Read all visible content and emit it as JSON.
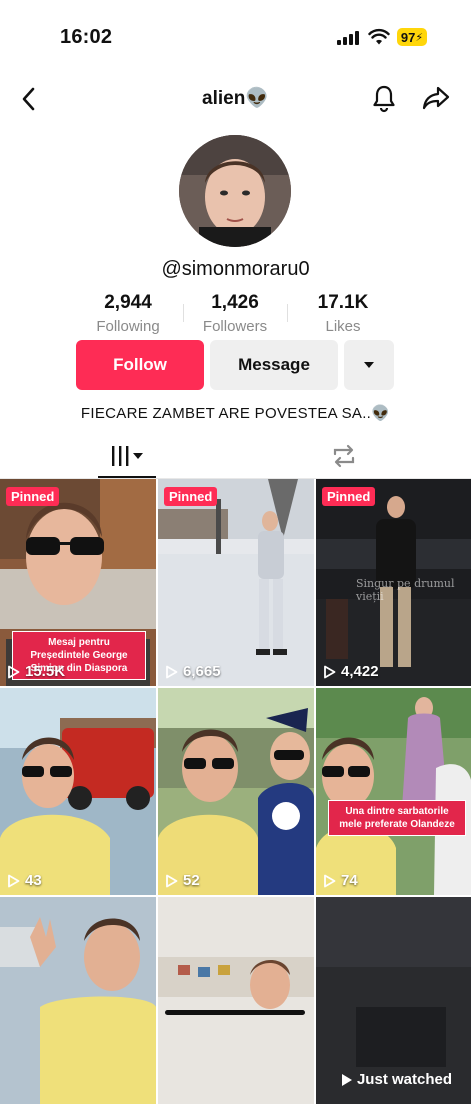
{
  "status_bar": {
    "time": "16:02",
    "battery": "97"
  },
  "header": {
    "title": "alien👽"
  },
  "profile": {
    "handle": "@simonmoraru0",
    "stats": [
      {
        "value": "2,944",
        "label": "Following"
      },
      {
        "value": "1,426",
        "label": "Followers"
      },
      {
        "value": "17.1K",
        "label": "Likes"
      }
    ],
    "follow_label": "Follow",
    "message_label": "Message",
    "bio": "FIECARE ZAMBET ARE POVESTEA SA..👽"
  },
  "colors": {
    "accent": "#fe2c55",
    "battery": "#ffd60a",
    "secondary_button": "#efefef"
  },
  "videos": [
    {
      "pinned": "Pinned",
      "views": "15.5K",
      "caption": "Mesaj pentru Președintele George Simion din Diaspora"
    },
    {
      "pinned": "Pinned",
      "views": "6,665"
    },
    {
      "pinned": "Pinned",
      "views": "4,422",
      "caption": "Singur pe drumul vieții"
    },
    {
      "views": "43"
    },
    {
      "views": "52"
    },
    {
      "views": "74",
      "caption": "Una dintre sarbatorile mele preferate Olandeze"
    },
    {},
    {},
    {
      "status": "Just watched"
    }
  ]
}
